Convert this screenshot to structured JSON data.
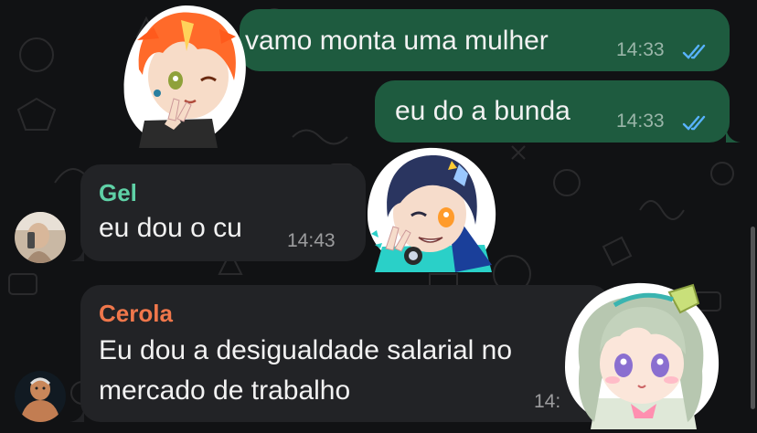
{
  "chat": {
    "messages": [
      {
        "text": "vamo monta uma mulher",
        "time": "14:33"
      },
      {
        "text": "eu do a bunda",
        "time": "14:33"
      },
      {
        "sender": "Gel",
        "text": "eu dou o cu",
        "time": "14:43"
      },
      {
        "sender": "Cerola",
        "text_line1": "Eu dou a desigualdade salarial no",
        "text_line2": "mercado de trabalho",
        "time": "14:"
      }
    ],
    "sticker_icons": [
      "sticker-orange-hair-boy-icon",
      "sticker-dark-hair-girl-icon",
      "sticker-green-hair-girl-icon"
    ]
  },
  "colors": {
    "background": "#111214",
    "outgoing_bubble": "#1e5b3f",
    "incoming_bubble": "#222326",
    "gel_name": "#5fd1a6",
    "cerola_name": "#f0774b",
    "read_ticks": "#58b3ff"
  }
}
